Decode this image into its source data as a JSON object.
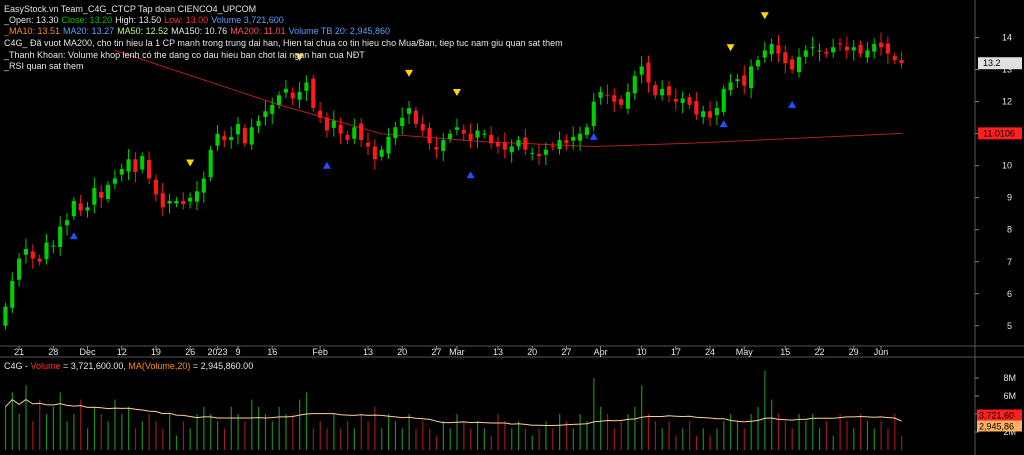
{
  "header": {
    "title": "EasyStock.vn Team_C4G_CTCP Tap doan CIENCO4_UPCOM",
    "ohlc": [
      {
        "label": "_Open: ",
        "value": "13.30",
        "color": "#e6e6e6"
      },
      {
        "label": "Close: ",
        "value": "13.20",
        "color": "#00c000"
      },
      {
        "label": "High: ",
        "value": "13.50",
        "color": "#e6e6e6"
      },
      {
        "label": "Low: ",
        "value": "13.00",
        "color": "#ff3030"
      },
      {
        "label": "Volume ",
        "value": "3,721,600",
        "color": "#5aa0ff"
      }
    ],
    "ma_line": [
      {
        "label": "_MA10: ",
        "value": "13.51",
        "color": "#ff8c1a"
      },
      {
        "label": "MA20: ",
        "value": "13.27",
        "color": "#5aa0ff"
      },
      {
        "label": "MA50: ",
        "value": "12.52",
        "color": "#b6ff7a"
      },
      {
        "label": "MA150: ",
        "value": "10.76",
        "color": "#e6e6e6"
      },
      {
        "label": "MA200: ",
        "value": "11.01",
        "color": "#ff5050"
      },
      {
        "label": "Volume TB 20: ",
        "value": "2,945,860",
        "color": "#5aa0ff"
      }
    ],
    "notes": [
      "C4G_ Đã vuot MA200, cho tin hieu la 1 CP manh trong trung dai han, Hien tai chua co tin hieu cho Mua/Ban, tiep tuc nam giu quan sat them",
      "_Thanh Khoan: Volume khop lenh có the dang co dau hieu ban chot lai ngan han cua NĐT",
      "_RSI quan sat them"
    ]
  },
  "volume_panel": {
    "header": "C4G - Volume = 3,721,600.00, MA(Volume,20) = 2,945,860.00",
    "header_parts": [
      {
        "text": "C4G - ",
        "color": "#e6e6e6"
      },
      {
        "text": "Volume",
        "color": "#ff3030"
      },
      {
        "text": " = 3,721,600.00, ",
        "color": "#e6e6e6"
      },
      {
        "text": "MA(Volume,20)",
        "color": "#ff8c1a"
      },
      {
        "text": " = 2,945,860.00",
        "color": "#e6e6e6"
      }
    ],
    "last_volume_label": "3,721,60",
    "ma_volume_label": "2,945,86"
  },
  "colors": {
    "up": "#00d000",
    "down": "#ff1a1a",
    "ma_line": "#b02020",
    "signal_up": "#2050ff",
    "signal_down": "#ffd700",
    "grid": "#2a2a2a",
    "axis_text": "#e6e6e6"
  },
  "chart_data": {
    "type": "candlestick",
    "x_tick_labels": [
      {
        "i": 2,
        "label": "21"
      },
      {
        "i": 7,
        "label": "28"
      },
      {
        "i": 12,
        "label": "Dec"
      },
      {
        "i": 17,
        "label": "12"
      },
      {
        "i": 22,
        "label": "19"
      },
      {
        "i": 27,
        "label": "26"
      },
      {
        "i": 31,
        "label": "2023"
      },
      {
        "i": 34,
        "label": "9"
      },
      {
        "i": 39,
        "label": "16"
      },
      {
        "i": 46,
        "label": "Feb"
      },
      {
        "i": 53,
        "label": "13"
      },
      {
        "i": 58,
        "label": "20"
      },
      {
        "i": 63,
        "label": "27"
      },
      {
        "i": 66,
        "label": "Mar"
      },
      {
        "i": 72,
        "label": "13"
      },
      {
        "i": 77,
        "label": "20"
      },
      {
        "i": 82,
        "label": "27"
      },
      {
        "i": 87,
        "label": "Apr"
      },
      {
        "i": 93,
        "label": "10"
      },
      {
        "i": 98,
        "label": "17"
      },
      {
        "i": 103,
        "label": "24"
      },
      {
        "i": 108,
        "label": "May"
      },
      {
        "i": 114,
        "label": "15"
      },
      {
        "i": 119,
        "label": "22"
      },
      {
        "i": 124,
        "label": "29"
      },
      {
        "i": 128,
        "label": "Jun"
      }
    ],
    "price_axis": {
      "min": 4.4,
      "max": 14.8,
      "ticks": [
        5,
        6,
        7,
        8,
        9,
        10,
        11,
        12,
        13,
        14
      ]
    },
    "volume_axis": {
      "max": 9000000,
      "ticks": [
        2000000,
        4000000,
        6000000,
        8000000
      ],
      "tick_labels": [
        "2M",
        "4M",
        "6M",
        "8M"
      ]
    },
    "price_labels": [
      {
        "value": 13.2,
        "text": "13.2",
        "bg": "#e0e0e0",
        "fg": "#000"
      },
      {
        "value": 11.01,
        "text": "11.0106",
        "bg": "#ff2020",
        "fg": "#000"
      }
    ],
    "ma200": {
      "name": "MA200",
      "start_index": 16,
      "values_at": [
        [
          16,
          13.6
        ],
        [
          40,
          11.9
        ],
        [
          55,
          11.0
        ],
        [
          70,
          10.75
        ],
        [
          86,
          10.6
        ],
        [
          100,
          10.7
        ],
        [
          131,
          11.01
        ]
      ]
    },
    "close": [
      5.6,
      6.4,
      7.1,
      7.4,
      7.1,
      7.0,
      7.6,
      7.5,
      8.1,
      8.3,
      8.9,
      8.6,
      8.7,
      9.3,
      9.0,
      9.4,
      9.6,
      9.9,
      10.2,
      9.8,
      10.3,
      9.6,
      9.1,
      8.7,
      8.9,
      8.9,
      8.8,
      9.0,
      9.2,
      9.6,
      10.5,
      11.0,
      10.8,
      10.9,
      11.3,
      10.7,
      11.2,
      11.4,
      11.7,
      11.9,
      12.2,
      12.4,
      12.1,
      12.3,
      12.6,
      11.8,
      11.5,
      11.1,
      11.4,
      11.0,
      10.8,
      11.2,
      10.8,
      10.6,
      10.2,
      10.5,
      10.9,
      11.2,
      11.5,
      11.8,
      11.3,
      11.1,
      10.7,
      10.5,
      10.8,
      11.0,
      11.2,
      11.0,
      10.8,
      11.1,
      11.0,
      10.7,
      10.6,
      10.5,
      10.6,
      10.8,
      10.5,
      10.4,
      10.3,
      10.5,
      10.6,
      10.8,
      10.7,
      10.9,
      11.0,
      11.2,
      12.0,
      12.3,
      12.2,
      12.0,
      11.9,
      12.3,
      12.8,
      13.1,
      12.6,
      12.2,
      12.4,
      12.2,
      12.0,
      12.1,
      11.9,
      11.6,
      11.7,
      11.5,
      11.8,
      12.4,
      12.6,
      12.7,
      12.5,
      13.1,
      13.3,
      13.6,
      13.8,
      13.5,
      13.2,
      13.0,
      13.4,
      13.6,
      13.7,
      13.6,
      13.5,
      13.7,
      13.8,
      13.6,
      13.7,
      13.5,
      13.6,
      13.8,
      13.7,
      13.5,
      13.3,
      13.2
    ],
    "volume_scale": [
      0.6,
      0.8,
      0.5,
      0.9,
      0.4,
      0.7,
      0.5,
      0.6,
      0.8,
      0.4,
      0.5,
      0.7,
      0.3,
      0.6,
      0.5,
      0.4,
      0.7,
      0.5,
      0.6,
      0.3,
      0.4,
      0.5,
      0.4,
      0.3,
      0.5,
      0.2,
      0.4,
      0.3,
      0.5,
      0.6,
      0.5,
      0.4,
      0.3,
      0.6,
      0.5,
      0.4,
      0.7,
      0.6,
      0.5,
      0.4,
      0.6,
      0.5,
      0.5,
      0.7,
      0.8,
      0.3,
      0.4,
      0.3,
      0.5,
      0.3,
      0.4,
      0.3,
      0.5,
      0.4,
      0.6,
      0.3,
      0.5,
      0.4,
      0.3,
      0.5,
      0.3,
      0.4,
      0.3,
      0.2,
      0.4,
      0.3,
      0.5,
      0.4,
      0.3,
      0.4,
      0.3,
      0.2,
      0.5,
      0.4,
      0.3,
      0.4,
      0.3,
      0.2,
      0.3,
      0.4,
      0.3,
      0.5,
      0.4,
      0.3,
      0.5,
      0.4,
      1.0,
      0.6,
      0.5,
      0.3,
      0.4,
      0.5,
      0.6,
      0.9,
      0.5,
      0.4,
      0.3,
      0.4,
      0.2,
      0.3,
      0.4,
      0.2,
      0.3,
      0.2,
      0.3,
      0.4,
      0.5,
      0.4,
      0.3,
      0.5,
      0.6,
      1.1,
      0.7,
      0.5,
      0.4,
      0.3,
      0.5,
      0.4,
      0.5,
      0.3,
      0.4,
      0.2,
      0.5,
      0.4,
      0.3,
      0.5,
      0.4,
      0.3,
      0.4,
      0.3,
      0.5,
      0.2,
      0.45
    ],
    "signals_up": [
      10,
      47,
      68,
      86,
      105,
      115
    ],
    "signals_down": [
      27,
      43,
      59,
      66,
      106,
      111
    ]
  }
}
